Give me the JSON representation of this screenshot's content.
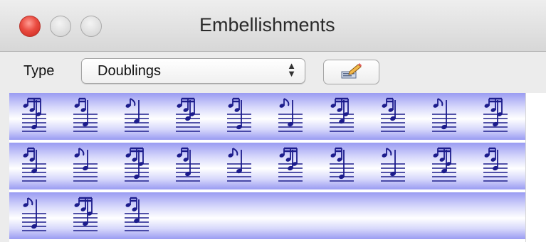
{
  "window": {
    "title": "Embellishments",
    "buttons": [
      "close-button",
      "minimize-button",
      "zoom-button"
    ]
  },
  "toolbar": {
    "type_label": "Type",
    "type_select": {
      "value": "Doublings",
      "arrows": "⌃⌄"
    },
    "edit_button_icon": "edit-pencil-icon"
  },
  "grid": {
    "rows": [
      {
        "count": 10
      },
      {
        "count": 10
      },
      {
        "count": 3
      }
    ],
    "colors": {
      "notation": "#1c1c8c",
      "row_band": "#9a9cf2"
    }
  }
}
